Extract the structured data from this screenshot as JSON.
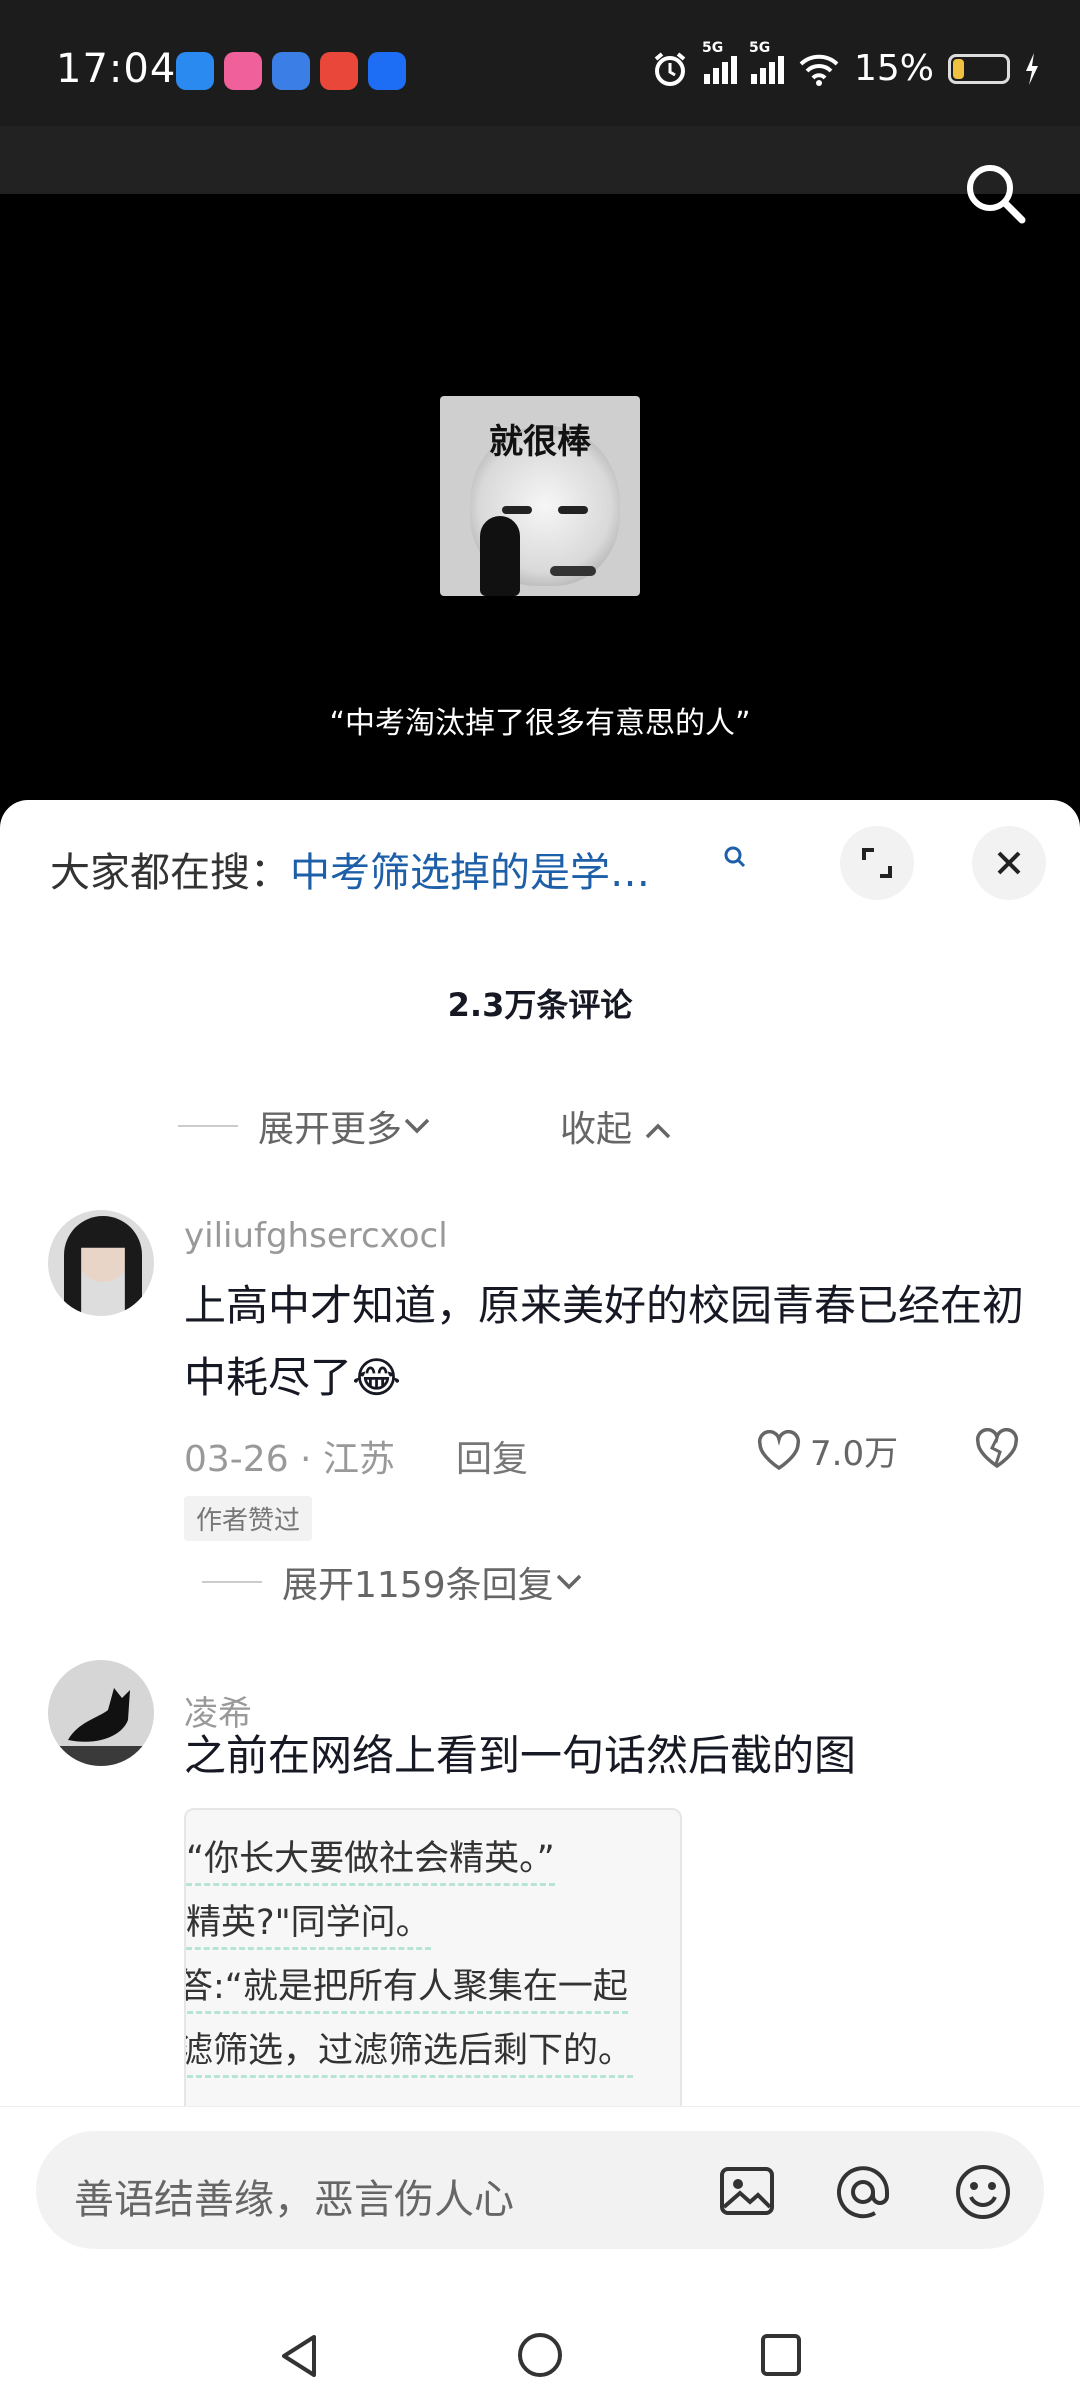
{
  "status_bar": {
    "time": "17:04",
    "battery": "15%",
    "network_1": "5G",
    "network_2": "5G",
    "icons": [
      "app-e-icon",
      "bilibili-icon",
      "app-blue-icon",
      "app-map-icon",
      "app-shield-icon",
      "alarm-icon",
      "wifi-icon",
      "charging-icon"
    ]
  },
  "video": {
    "meme_caption": "就很棒",
    "subtitle": "“中考淘汰掉了很多有意思的人”"
  },
  "sheet": {
    "search_prefix": "大家都在搜：",
    "search_link": "中考筛选掉的是学…",
    "comment_count": "2.3万条评论",
    "expand_more": "展开更多",
    "collapse": "收起"
  },
  "comments": [
    {
      "username": "yiliufghsercxocl",
      "text": "上高中才知道，原来美好的校园青春已经在初中耗尽了😂",
      "date_location": "03-26 · 江苏",
      "reply_label": "回复",
      "likes": "7.0万",
      "author_tag": "作者赞过",
      "expand_replies": "展开1159条回复"
    },
    {
      "username": "凌希",
      "text": "之前在网络上看到一句话然后截的图",
      "image_lines": [
        "“你长大要做社会精英。”",
        "精英?\"同学问。",
        "答:“就是把所有人聚集在一起",
        "滤筛选，过滤筛选后剩下的。"
      ]
    }
  ],
  "input": {
    "placeholder": "善语结善缘，恶言伤人心"
  },
  "colors": {
    "link": "#1d5fa8",
    "battery": "#f0c040"
  }
}
